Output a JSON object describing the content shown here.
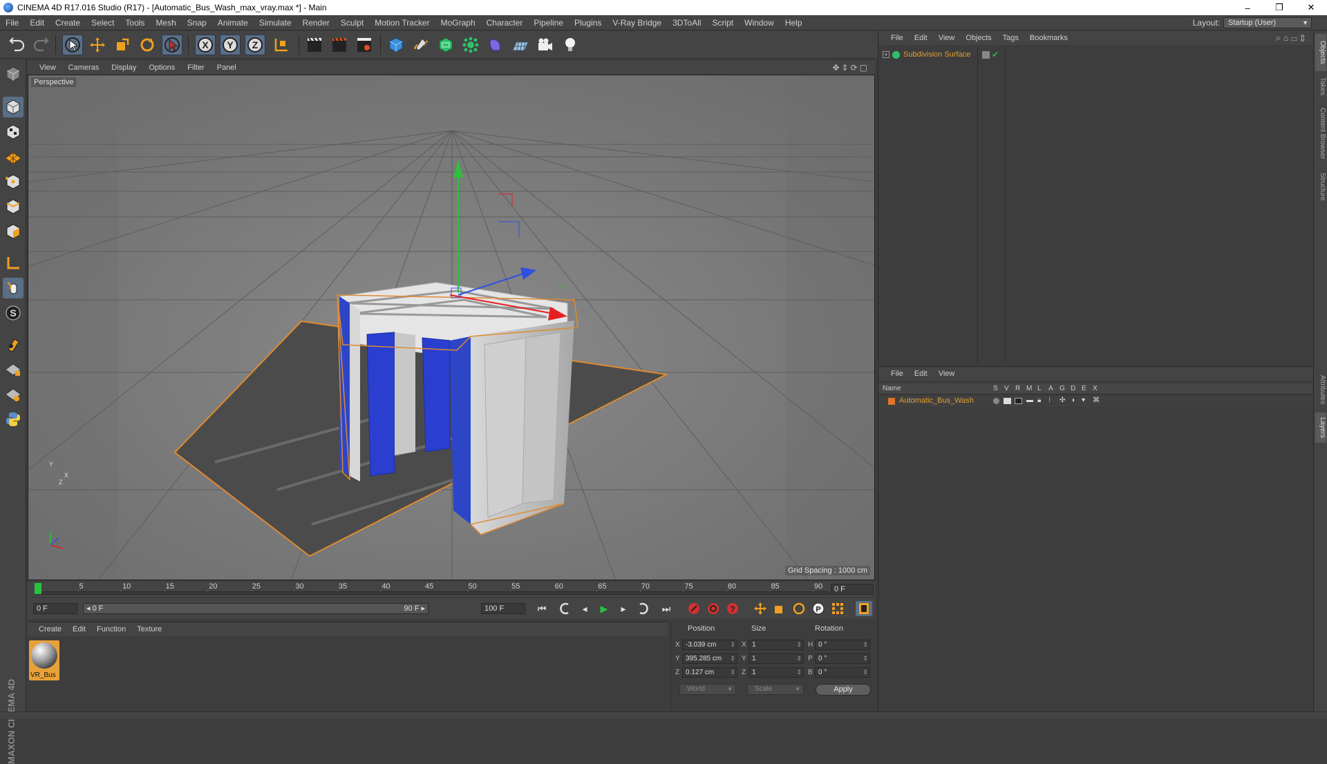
{
  "window": {
    "title": "CINEMA 4D R17.016 Studio (R17) - [Automatic_Bus_Wash_max_vray.max *] - Main",
    "minimize": "–",
    "restore": "❐",
    "close": "✕"
  },
  "menubar": {
    "items": [
      "File",
      "Edit",
      "Create",
      "Select",
      "Tools",
      "Mesh",
      "Snap",
      "Animate",
      "Simulate",
      "Render",
      "Sculpt",
      "Motion Tracker",
      "MoGraph",
      "Character",
      "Pipeline",
      "Plugins",
      "V-Ray Bridge",
      "3DToAll",
      "Script",
      "Window",
      "Help"
    ],
    "layout_label": "Layout:",
    "layout_value": "Startup (User)"
  },
  "toolbar": {
    "icons": [
      "undo-icon",
      "redo-icon",
      "live-selection-icon",
      "move-icon",
      "scale-icon",
      "rotate-icon",
      "recent-tool-icon",
      "x-axis-icon",
      "y-axis-icon",
      "z-axis-icon",
      "coordinate-system-icon",
      "render-view-icon",
      "render-picture-viewer-icon",
      "render-settings-icon",
      "cube-icon",
      "pen-spline-icon",
      "subdivision-nurbs-icon",
      "array-icon",
      "deformer-icon",
      "floor-icon",
      "camera-icon",
      "light-icon"
    ]
  },
  "viewport": {
    "menus": [
      "View",
      "Cameras",
      "Display",
      "Options",
      "Filter",
      "Panel"
    ],
    "label": "Perspective",
    "grid_spacing": "Grid Spacing : 1000 cm",
    "axis_y": "Y",
    "axis_x": "X",
    "axis_z": "Z"
  },
  "timeline": {
    "ticks": [
      "0",
      "5",
      "10",
      "15",
      "20",
      "25",
      "30",
      "35",
      "40",
      "45",
      "50",
      "55",
      "60",
      "65",
      "70",
      "75",
      "80",
      "85",
      "90"
    ],
    "current_frame": "0 F"
  },
  "transport": {
    "start_frame": "0 F",
    "range_start": "◂ 0 F",
    "range_end": "90 F ▸",
    "end_frame": "100 F"
  },
  "material_manager": {
    "menus": [
      "Create",
      "Edit",
      "Function",
      "Texture"
    ],
    "materials": [
      {
        "name": "VR_Bus"
      }
    ]
  },
  "coordinates": {
    "headers": {
      "position": "Position",
      "size": "Size",
      "rotation": "Rotation"
    },
    "rows": [
      {
        "axis": "X",
        "position": "-3.039 cm",
        "size_axis": "X",
        "size": "1",
        "rot_axis": "H",
        "rotation": "0 °"
      },
      {
        "axis": "Y",
        "position": "395.285 cm",
        "size_axis": "Y",
        "size": "1",
        "rot_axis": "P",
        "rotation": "0 °"
      },
      {
        "axis": "Z",
        "position": "0.127 cm",
        "size_axis": "Z",
        "size": "1",
        "rot_axis": "B",
        "rotation": "0 °"
      }
    ],
    "mode": "World",
    "size_mode": "Scale",
    "apply": "Apply"
  },
  "object_manager": {
    "menus": [
      "File",
      "Edit",
      "View",
      "Objects",
      "Tags",
      "Bookmarks"
    ],
    "objects": [
      {
        "name": "Subdivision Surface"
      }
    ]
  },
  "layer_manager": {
    "menus": [
      "File",
      "Edit",
      "View"
    ],
    "columns": [
      "Name",
      "S",
      "V",
      "R",
      "M",
      "L",
      "A",
      "G",
      "D",
      "E",
      "X"
    ],
    "layers": [
      {
        "name": "Automatic_Bus_Wash",
        "color": "#e0742a"
      }
    ]
  },
  "right_tabs": [
    "Objects",
    "Takes",
    "Content Browser",
    "Structure",
    "Attributes",
    "Layers"
  ],
  "branding": "MAXON CINEMA 4D",
  "colors": {
    "accent_orange": "#e0742a",
    "selection_blue": "#5a6e86",
    "play_green": "#27c23f"
  }
}
